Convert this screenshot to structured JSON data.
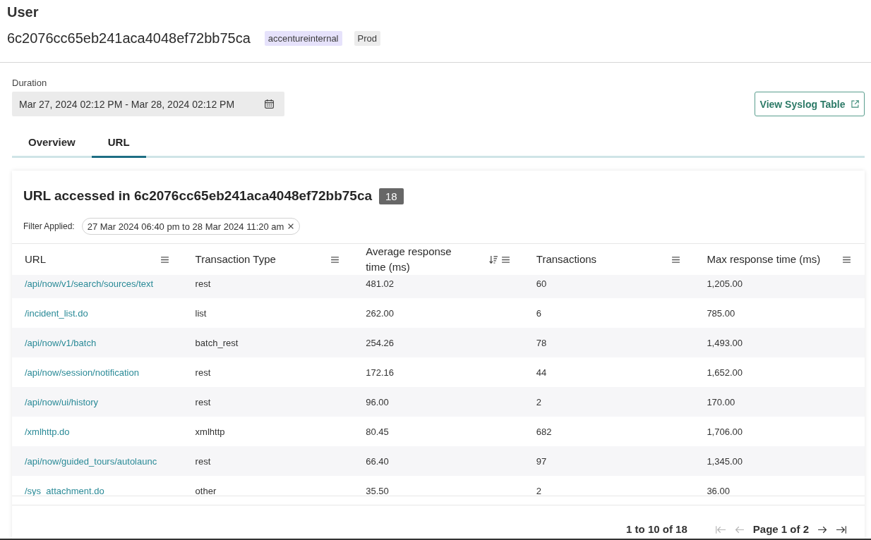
{
  "header": {
    "title": "User",
    "id": "6c2076cc65eb241aca4048ef72bb75ca",
    "tags": [
      {
        "label": "accentureinternal",
        "color": "#e6e2fb"
      },
      {
        "label": "Prod",
        "color": "#ececec"
      }
    ]
  },
  "duration": {
    "label": "Duration",
    "value": "Mar 27, 2024 02:12 PM - Mar 28, 2024 02:12 PM"
  },
  "syslog_button": {
    "label": "View Syslog Table"
  },
  "tabs": [
    {
      "label": "Overview",
      "selected": false
    },
    {
      "label": "URL",
      "selected": true
    }
  ],
  "panel": {
    "title": "URL accessed in 6c2076cc65eb241aca4048ef72bb75ca",
    "count": "18",
    "filter_label": "Filter Applied:",
    "filters": [
      {
        "label": "27 Mar 2024 06:40 pm to 28 Mar 2024 11:20 am"
      }
    ],
    "table": {
      "columns": [
        {
          "label": "URL",
          "kind": "link",
          "sorted": false
        },
        {
          "label": "Transaction Type",
          "kind": "text",
          "sorted": false
        },
        {
          "label": "Average response time (ms)",
          "kind": "text",
          "sorted": true
        },
        {
          "label": "Transactions",
          "kind": "text",
          "sorted": false
        },
        {
          "label": "Max response time (ms)",
          "kind": "text",
          "sorted": false
        }
      ],
      "rows": [
        [
          "/api/now/v1/search/sources/text",
          "rest",
          "481.02",
          "60",
          "1,205.00"
        ],
        [
          "/incident_list.do",
          "list",
          "262.00",
          "6",
          "785.00"
        ],
        [
          "/api/now/v1/batch",
          "batch_rest",
          "254.26",
          "78",
          "1,493.00"
        ],
        [
          "/api/now/session/notification",
          "rest",
          "172.16",
          "44",
          "1,652.00"
        ],
        [
          "/api/now/ui/history",
          "rest",
          "96.00",
          "2",
          "170.00"
        ],
        [
          "/xmlhttp.do",
          "xmlhttp",
          "80.45",
          "682",
          "1,706.00"
        ],
        [
          "/api/now/guided_tours/autolaunc",
          "rest",
          "66.40",
          "97",
          "1,345.00"
        ],
        [
          "/sys_attachment.do",
          "other",
          "35.50",
          "2",
          "36.00"
        ]
      ]
    },
    "pagination": {
      "summary": "1 to 10 of 18",
      "items": [
        {
          "kind": "first",
          "disabled": true
        },
        {
          "kind": "previous",
          "disabled": true
        },
        {
          "kind": "page",
          "label": "Page 1 of 2"
        },
        {
          "kind": "next",
          "disabled": false
        },
        {
          "kind": "last",
          "disabled": false
        }
      ]
    }
  }
}
